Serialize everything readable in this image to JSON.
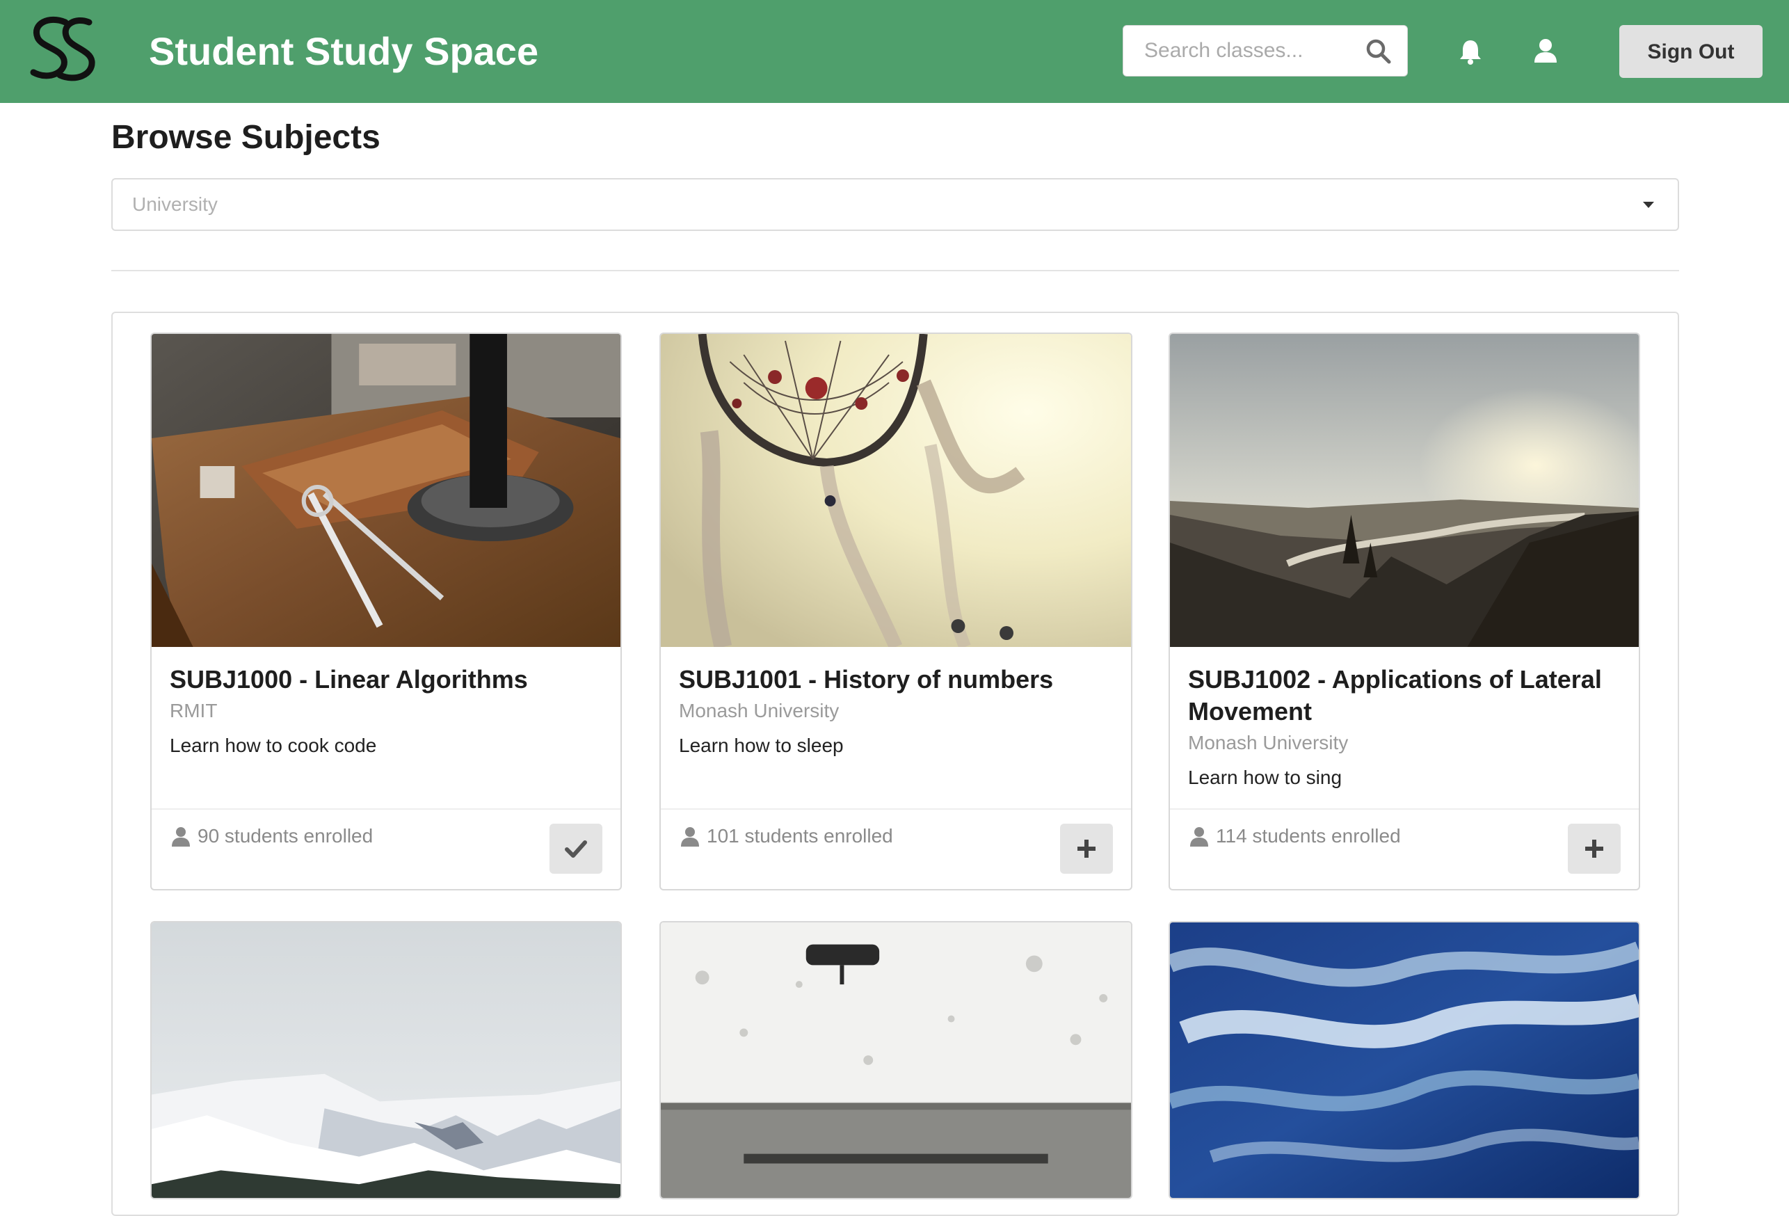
{
  "colors": {
    "brand": "#4f9f6c",
    "header_text": "#ffffff",
    "button_bg": "#e4e4e4"
  },
  "header": {
    "logo_icon": "ss-monogram-logo",
    "title": "Student Study Space",
    "search_placeholder": "Search classes...",
    "search_icon": "search-icon",
    "notifications_icon": "bell-icon",
    "profile_icon": "user-icon",
    "signout_label": "Sign Out"
  },
  "main": {
    "title": "Browse Subjects",
    "filter": {
      "placeholder": "University",
      "icon": "chevron-down-icon"
    },
    "cards": [
      {
        "title": "SUBJ1000 - Linear Algorithms",
        "university": "RMIT",
        "description": "Learn how to cook code",
        "enrolled": "90 students enrolled",
        "enrolled_icon": "person-icon",
        "action_icon": "check-icon",
        "image": "desk with compass and leather notebook"
      },
      {
        "title": "SUBJ1001 - History of numbers",
        "university": "Monash University",
        "description": "Learn how to sleep",
        "enrolled": "101 students enrolled",
        "enrolled_icon": "person-icon",
        "action_icon": "plus-icon",
        "image": "dreamcatcher against sunlight"
      },
      {
        "title": "SUBJ1002 - Applications of Lateral Movement",
        "university": "Monash University",
        "description": "Learn how to sing",
        "enrolled": "114 students enrolled",
        "enrolled_icon": "person-icon",
        "action_icon": "plus-icon",
        "image": "mountain valley river at sunset"
      }
    ],
    "partial_cards": [
      {
        "image": "snowy mountains"
      },
      {
        "image": "weathered white wall with bench"
      },
      {
        "image": "blue ocean waves"
      }
    ]
  }
}
